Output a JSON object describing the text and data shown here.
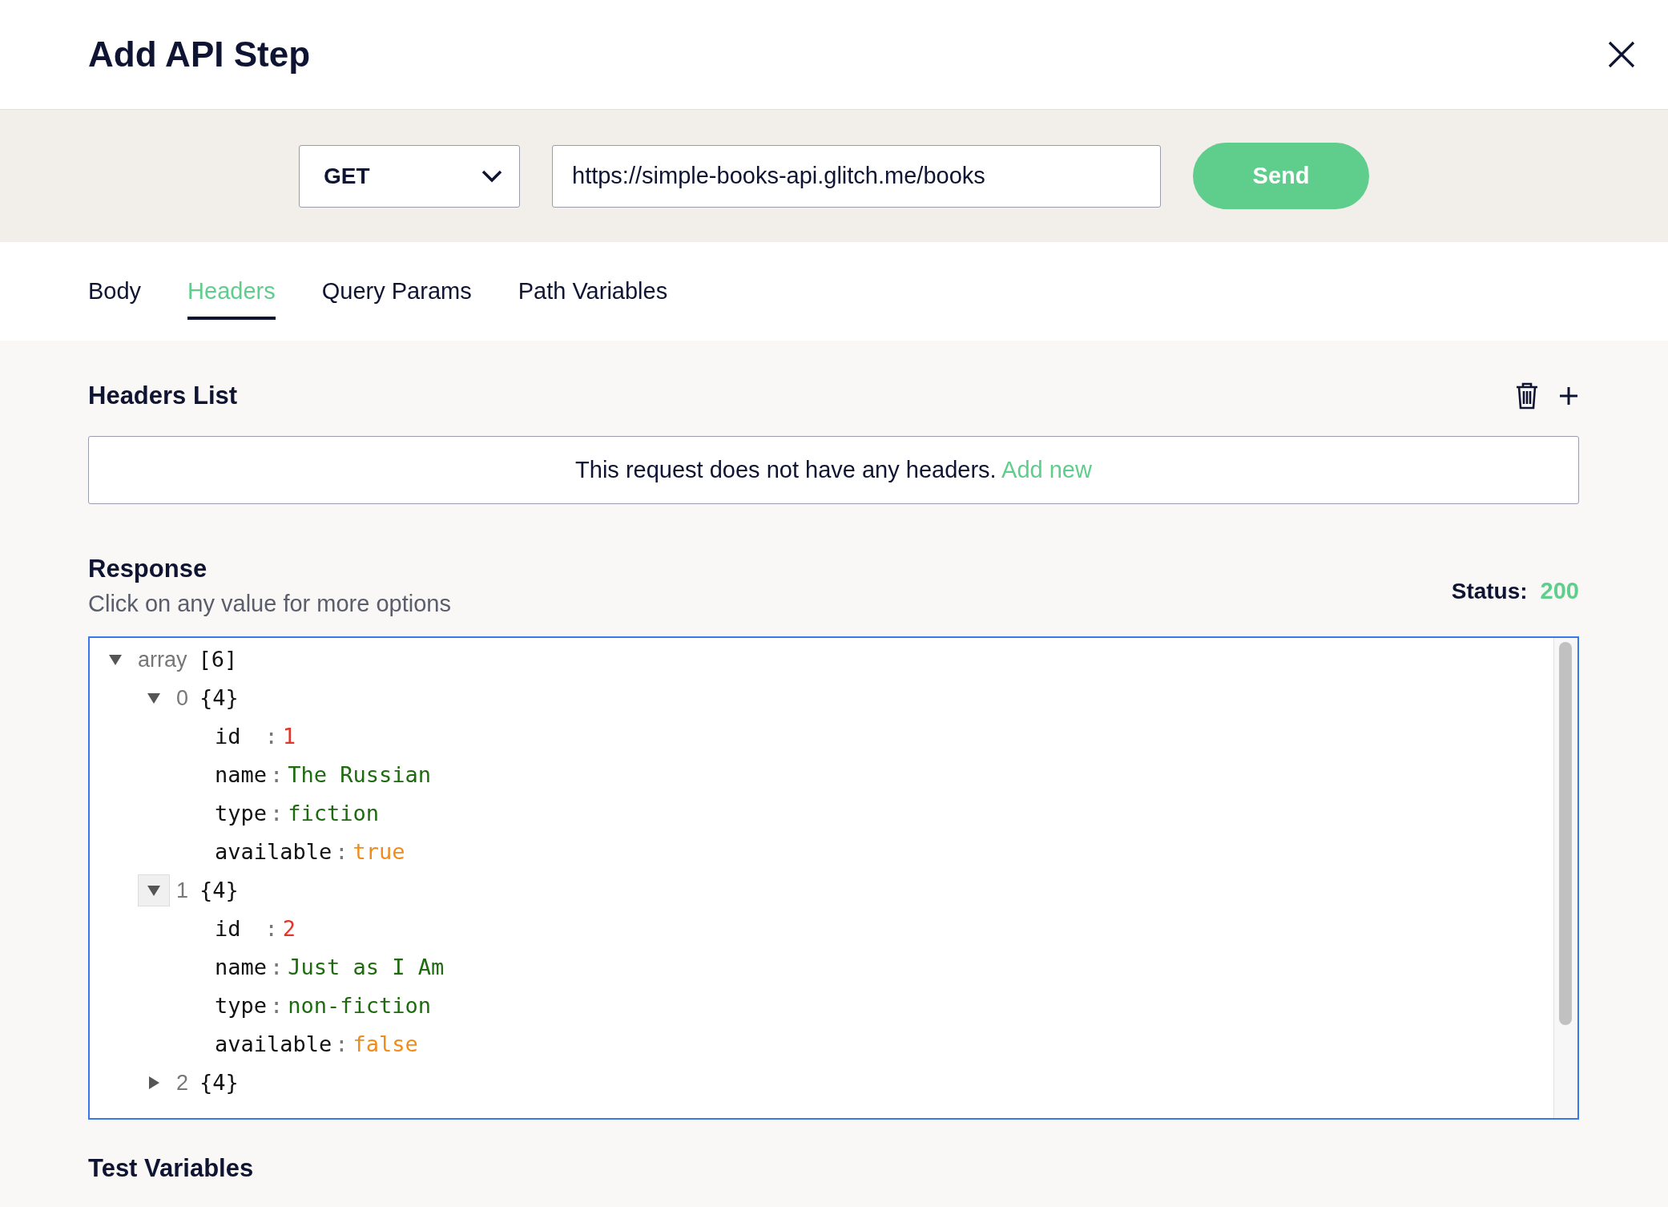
{
  "dialog": {
    "title": "Add API Step"
  },
  "request": {
    "method": "GET",
    "url": "https://simple-books-api.glitch.me/books",
    "send_label": "Send"
  },
  "tabs": [
    {
      "label": "Body",
      "selected": false
    },
    {
      "label": "Headers",
      "selected": true
    },
    {
      "label": "Query Params",
      "selected": false
    },
    {
      "label": "Path Variables",
      "selected": false
    }
  ],
  "headers": {
    "title": "Headers List",
    "empty_text": "This request does not have any headers.",
    "add_link": "Add new"
  },
  "response": {
    "title": "Response",
    "hint": "Click on any value for more options",
    "status_label": "Status:",
    "status": "200",
    "tree": {
      "type_label": "array",
      "count": "[6]",
      "expanded": true,
      "children": [
        {
          "key": "0",
          "count": "{4}",
          "expanded": true,
          "hovered": false,
          "children": [
            {
              "key": "id",
              "separator": ":",
              "value": "1",
              "kind": "number"
            },
            {
              "key": "name",
              "separator": ":",
              "value": "The Russian",
              "kind": "string"
            },
            {
              "key": "type",
              "separator": ":",
              "value": "fiction",
              "kind": "string"
            },
            {
              "key": "available",
              "separator": ":",
              "value": "true",
              "kind": "boolean"
            }
          ]
        },
        {
          "key": "1",
          "count": "{4}",
          "expanded": true,
          "hovered": true,
          "children": [
            {
              "key": "id",
              "separator": ":",
              "value": "2",
              "kind": "number"
            },
            {
              "key": "name",
              "separator": ":",
              "value": "Just as I Am",
              "kind": "string"
            },
            {
              "key": "type",
              "separator": ":",
              "value": "non-fiction",
              "kind": "string"
            },
            {
              "key": "available",
              "separator": ":",
              "value": "false",
              "kind": "boolean"
            }
          ]
        },
        {
          "key": "2",
          "count": "{4}",
          "expanded": false,
          "hovered": false
        }
      ]
    }
  },
  "test_variables": {
    "title": "Test Variables"
  }
}
